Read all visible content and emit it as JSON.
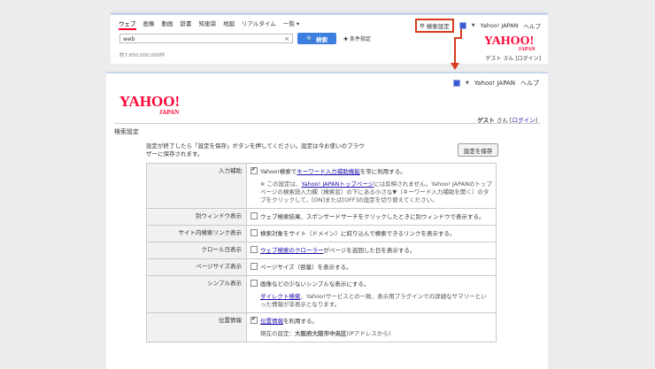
{
  "top": {
    "tabs": [
      "ウェブ",
      "画像",
      "動画",
      "辞書",
      "知恵袋",
      "地図",
      "リアルタイム",
      "一覧 ▾"
    ],
    "search_settings": "検索設定",
    "yahoo_japan": "Yahoo! JAPAN",
    "help": "ヘルプ",
    "query": "web",
    "clear": "×",
    "search_button": "検索",
    "advanced": "条件指定",
    "result_count": "約7,650,000,000件",
    "guest": "ゲスト さん [ログイン]"
  },
  "main": {
    "yahoo_japan": "Yahoo! JAPAN",
    "help": "ヘルプ",
    "guest_prefix": "ゲスト",
    "guest_suffix": "さん [",
    "login": "ログイン",
    "guest_end": "]",
    "title": "検索設定",
    "intro": "設定が終了したら「設定を保存」ボタンを押してください。設定は今お使いのブラウザーに保存されます。",
    "save_button": "設定を保存",
    "rows": [
      {
        "label": "入力補助",
        "checked": true,
        "pre": "Yahoo!検索で",
        "link": "キーワード入力補助機能",
        "post": "を常に利用する。",
        "note_pre": "※ この設定は、",
        "note_link": "Yahoo! JAPANトップページ",
        "note_post": "には反映されません。Yahoo! JAPANのトップページの検索語入力欄（検索窓）の下にある小さな▼（キーワード入力補助を開く）のタブをクリックして、[ON]または[OFF]の設定を切り替えてください。"
      },
      {
        "label": "別ウィンドウ表示",
        "checked": false,
        "text": "ウェブ検索結果、スポンサードサーチをクリックしたときに別ウィンドウで表示する。"
      },
      {
        "label": "サイト内検索リンク表示",
        "checked": false,
        "text": "検索対象をサイト（ドメイン）に絞り込んで検索できるリンクを表示する。"
      },
      {
        "label": "クロール日表示",
        "checked": false,
        "link": "ウェブ検索のクローラー",
        "post": "がページを巡回した日を表示する。"
      },
      {
        "label": "ページサイズ表示",
        "checked": false,
        "text": "ページサイズ（容量）を表示する。"
      },
      {
        "label": "シンプル表示",
        "checked": false,
        "text": "画像などの少ないシンプルな表示にする。",
        "sub_link": "ダイレクト検索",
        "sub_post": "、Yahoo!サービスとの一致、表示用プラグインでの詳細なサマリーといった情報が非表示となります。"
      },
      {
        "label": "位置情報",
        "checked": true,
        "link": "位置情報",
        "post": "を利用する。",
        "sub_pre": "現在の設定：",
        "sub_bold": "大阪府大阪市中央区",
        "sub_post": "(IPアドレスから)"
      }
    ]
  },
  "colors": {
    "accent_red": "#d63b1f",
    "link": "#1a0dab",
    "button_blue": "#3d7fe0",
    "brand": "#ff0033"
  }
}
